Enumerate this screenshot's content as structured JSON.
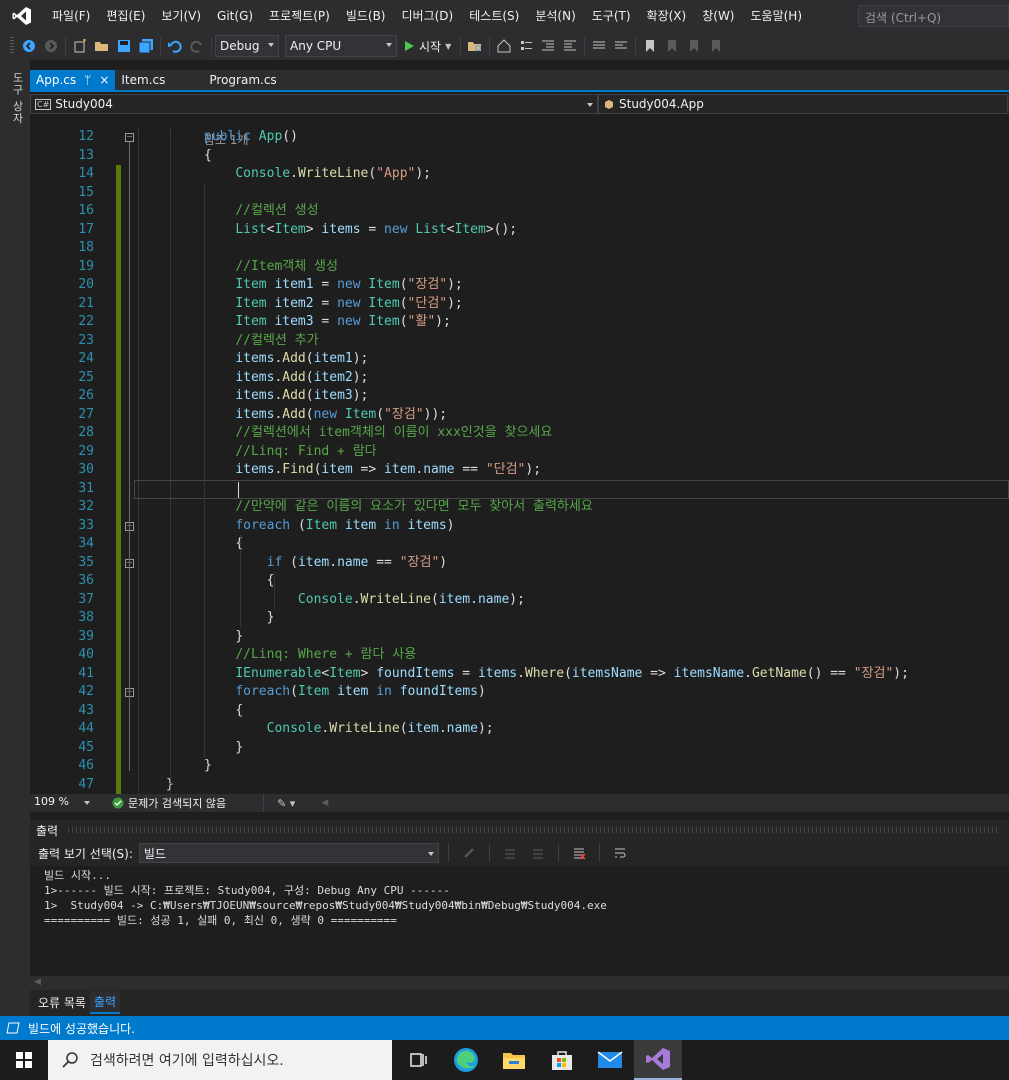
{
  "menu": [
    "파일(F)",
    "편집(E)",
    "보기(V)",
    "Git(G)",
    "프로젝트(P)",
    "빌드(B)",
    "디버그(D)",
    "테스트(S)",
    "분석(N)",
    "도구(T)",
    "확장(X)",
    "창(W)",
    "도움말(H)"
  ],
  "search_placeholder": "검색 (Ctrl+Q)",
  "toolbar": {
    "config": "Debug",
    "platform": "Any CPU",
    "start": "시작"
  },
  "side_label": "도구 상자",
  "tabs": [
    {
      "label": "App.cs",
      "pin": "ᛘ",
      "close": "×"
    },
    {
      "label": "Item.cs"
    },
    {
      "label": "Program.cs"
    }
  ],
  "nav": {
    "project": "Study004",
    "cs_badge": "C#",
    "class": "Study004.App"
  },
  "code": {
    "ref_hint": "참조 1개",
    "lines": [
      {
        "n": "12"
      },
      {
        "n": "13"
      },
      {
        "n": "14"
      },
      {
        "n": "15"
      },
      {
        "n": "16"
      },
      {
        "n": "17"
      },
      {
        "n": "18"
      },
      {
        "n": "19"
      },
      {
        "n": "20"
      },
      {
        "n": "21"
      },
      {
        "n": "22"
      },
      {
        "n": "23"
      },
      {
        "n": "24"
      },
      {
        "n": "25"
      },
      {
        "n": "26"
      },
      {
        "n": "27"
      },
      {
        "n": "28"
      },
      {
        "n": "29"
      },
      {
        "n": "30"
      },
      {
        "n": "31"
      },
      {
        "n": "32"
      },
      {
        "n": "33"
      },
      {
        "n": "34"
      },
      {
        "n": "35"
      },
      {
        "n": "36"
      },
      {
        "n": "37"
      },
      {
        "n": "38"
      },
      {
        "n": "39"
      },
      {
        "n": "40"
      },
      {
        "n": "41"
      },
      {
        "n": "42"
      },
      {
        "n": "43"
      },
      {
        "n": "44"
      },
      {
        "n": "45"
      },
      {
        "n": "46"
      },
      {
        "n": "47"
      }
    ],
    "t": {
      "public": "public",
      "App": "App",
      "parens": "()",
      "lbrace": "{",
      "rbrace": "}",
      "Console": "Console",
      "dot": ".",
      "WriteLine": "WriteLine",
      "str_app": "\"App\"",
      "close_semi": ");",
      "cm_collection": "//컬렉션 생성",
      "List": "List",
      "lt": "<",
      "Item": "Item",
      "gt": ">",
      "items": "items",
      "eq": " = ",
      "new": "new",
      "new_list_end": "();",
      "cm_item": "//Item객체 생성",
      "item1": "item1",
      "item2": "item2",
      "item3": "item3",
      "lparen": "(",
      "str_jang": "\"장검\"",
      "str_dan": "\"단검\"",
      "str_hwal": "\"활\"",
      "cm_add": "//컬렉션 추가",
      "Add": "Add",
      "Find": "Find",
      "close_paren": ")",
      "close2_semi": "));",
      "cm_find": "//컬렉션에서 item객체의 이름이 xxx인것을 찾으세요",
      "cm_linq1": "//Linq: Find + 람다",
      "item": "item",
      "arrow": " => ",
      "name": "name",
      "eqeq": " == ",
      "cm_foreach": "//만약에 같은 이름의 요소가 있다면 모두 찾아서 출력하세요",
      "foreach": "foreach",
      "in": "in",
      "if": "if",
      "cm_linq2": "//Linq: Where + 람다 사용",
      "IEnumerable": "IEnumerable",
      "foundItems": "foundItems",
      "Where": "Where",
      "itemsName": "itemsName",
      "GetName": "GetName",
      "sp": " "
    }
  },
  "editor_status": {
    "zoom": "109 %",
    "issues": "문제가 검색되지 않음"
  },
  "output": {
    "title": "출력",
    "show_label": "출력 보기 선택(S):",
    "source": "빌드",
    "lines": [
      "빌드 시작...",
      "1>------ 빌드 시작: 프로젝트: Study004, 구성: Debug Any CPU ------",
      "1>  Study004 -> C:₩Users₩TJOEUN₩source₩repos₩Study004₩Study004₩bin₩Debug₩Study004.exe",
      "========== 빌드: 성공 1, 실패 0, 최신 0, 생략 0 =========="
    ]
  },
  "bottom_tabs": [
    "오류 목록",
    "출력"
  ],
  "status": {
    "message": "빌드에 성공했습니다."
  },
  "taskbar": {
    "search_placeholder": "검색하려면 여기에 입력하십시오."
  },
  "colors": {
    "accent": "#007acc",
    "editor_bg": "#1e1e1e",
    "chrome_bg": "#2d2d30"
  }
}
